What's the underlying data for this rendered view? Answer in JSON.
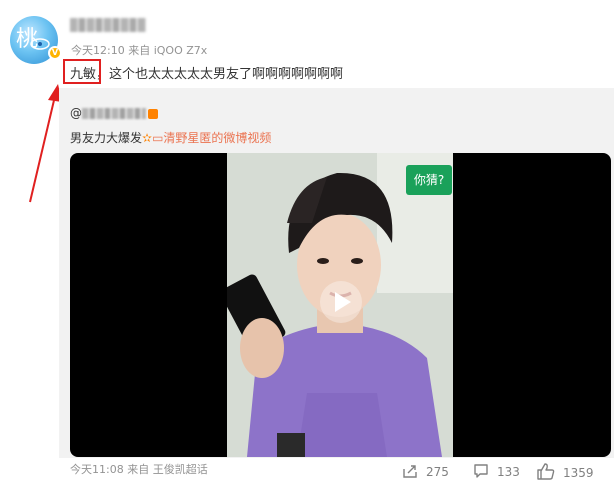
{
  "post": {
    "time": "今天12:10",
    "source_prefix": "来自",
    "source": "iQOO Z7x",
    "text_highlight": "九敏",
    "text_rest": "，这个也太太太太太男友了啊啊啊啊啊啊啊"
  },
  "repost": {
    "text_prefix": "男友力大爆发",
    "link_text": "清野星匿的微博视频",
    "time": "今天11:08",
    "source_prefix": "来自",
    "source": "王俊凯超话"
  },
  "video": {
    "caption": "你猜?"
  },
  "actions": {
    "repost_count": "275",
    "comment_count": "133",
    "like_count": "1359"
  },
  "colors": {
    "accent_link": "#eb7350",
    "annotation_red": "#e02020",
    "caption_green": "#1aa15a"
  }
}
